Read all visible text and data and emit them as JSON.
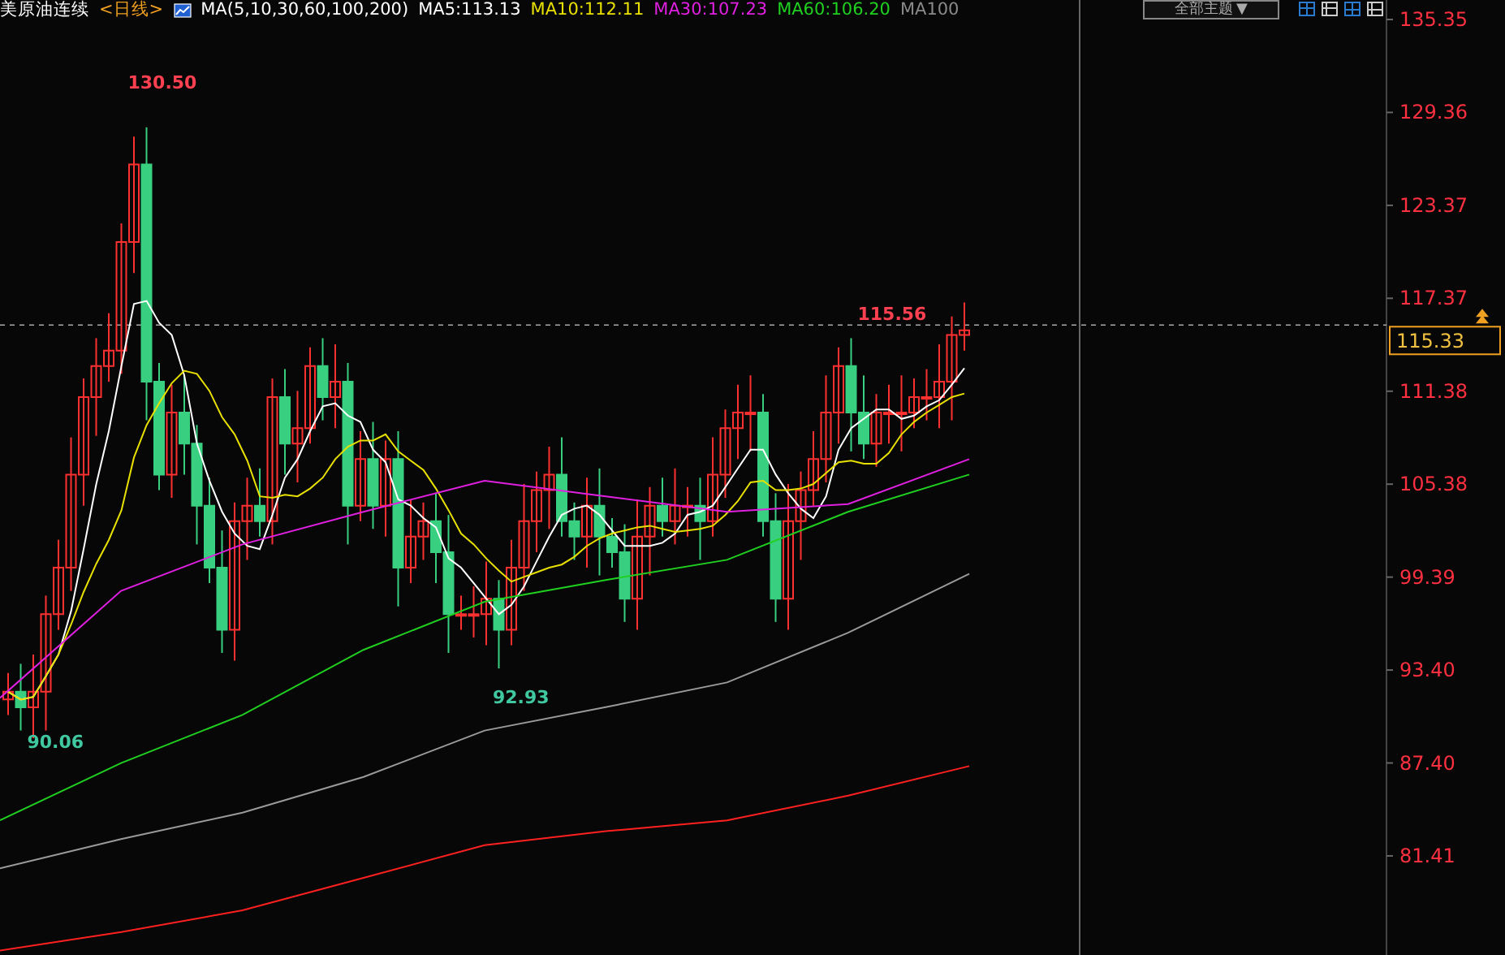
{
  "header": {
    "title": "美原油连续",
    "period": "<日线>",
    "legend": [
      {
        "text": "MA(5,10,30,60,100,200)",
        "color": "#ffffff",
        "icon": true
      },
      {
        "text": "MA5:113.13",
        "color": "#ffffff",
        "icon": false
      },
      {
        "text": "MA10:112.11",
        "color": "#e8e000",
        "icon": false
      },
      {
        "text": "MA30:107.23",
        "color": "#e020e0",
        "icon": false
      },
      {
        "text": "MA60:106.20",
        "color": "#20d020",
        "icon": false
      },
      {
        "text": "MA100",
        "color": "#8a8a8a",
        "icon": false
      }
    ],
    "theme_button": {
      "label": "全部主题",
      "caret": "▼"
    }
  },
  "price_axis": [
    "135.35",
    "129.36",
    "123.37",
    "117.37",
    "111.38",
    "105.38",
    "99.39",
    "93.40",
    "87.40",
    "81.41"
  ],
  "price_marks": [
    {
      "text": "130.50",
      "kind": "high"
    },
    {
      "text": "90.06",
      "kind": "low"
    },
    {
      "text": "92.93",
      "kind": "low"
    },
    {
      "text": "115.56",
      "kind": "high"
    }
  ],
  "current_price": "115.33"
}
